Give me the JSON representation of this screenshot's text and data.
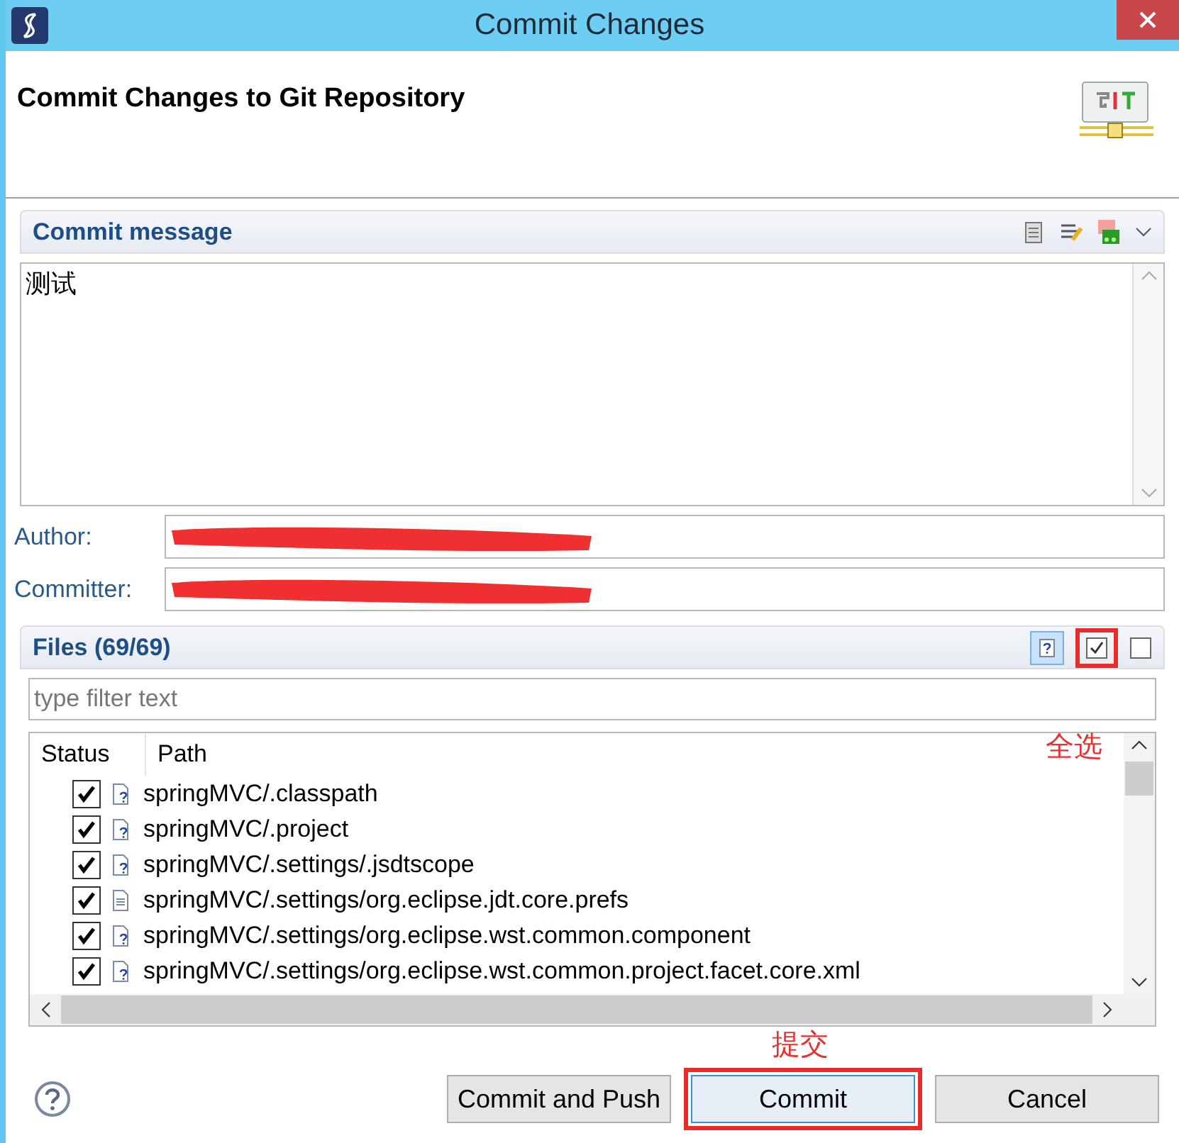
{
  "window": {
    "title": "Commit Changes"
  },
  "header": {
    "title": "Commit Changes to Git Repository"
  },
  "commit_message": {
    "title": "Commit message",
    "value": "测试"
  },
  "author": {
    "label": "Author:"
  },
  "committer": {
    "label": "Committer:"
  },
  "files": {
    "title": "Files (69/69)",
    "filter": {
      "placeholder": "type filter text"
    },
    "columns": [
      "Status",
      "Path"
    ],
    "rows": [
      {
        "checked": true,
        "kind": "untracked",
        "path": "springMVC/.classpath"
      },
      {
        "checked": true,
        "kind": "untracked",
        "path": "springMVC/.project"
      },
      {
        "checked": true,
        "kind": "untracked",
        "path": "springMVC/.settings/.jsdtscope"
      },
      {
        "checked": true,
        "kind": "text",
        "path": "springMVC/.settings/org.eclipse.jdt.core.prefs"
      },
      {
        "checked": true,
        "kind": "untracked",
        "path": "springMVC/.settings/org.eclipse.wst.common.component"
      },
      {
        "checked": true,
        "kind": "untracked",
        "path": "springMVC/.settings/org.eclipse.wst.common.project.facet.core.xml"
      }
    ]
  },
  "annotations": {
    "select_all": "全选",
    "commit": "提交"
  },
  "buttons": [
    {
      "label": "Commit and Push",
      "selected": false
    },
    {
      "label": "Commit",
      "selected": true
    },
    {
      "label": "Cancel",
      "selected": false
    }
  ]
}
